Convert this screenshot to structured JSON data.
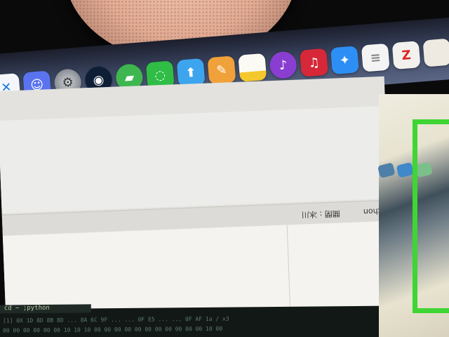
{
  "dock": {
    "icons": [
      {
        "name": "xcode-icon",
        "glyph": "✕"
      },
      {
        "name": "chat-app-icon",
        "glyph": "☺",
        "badge": true
      },
      {
        "name": "system-preferences-icon",
        "glyph": "⚙",
        "badge": true
      },
      {
        "name": "steam-icon",
        "glyph": "◉"
      },
      {
        "name": "green-app-icon",
        "glyph": "▰"
      },
      {
        "name": "wechat-icon",
        "glyph": "◌"
      },
      {
        "name": "blue-app-icon",
        "glyph": "⬆"
      },
      {
        "name": "pencil-app-icon",
        "glyph": "✎"
      },
      {
        "name": "notes-icon",
        "glyph": ""
      },
      {
        "name": "purple-app-icon",
        "glyph": "♪"
      },
      {
        "name": "red-music-icon",
        "glyph": "♫"
      },
      {
        "name": "bird-app-icon",
        "glyph": "✦"
      },
      {
        "name": "reminders-icon",
        "glyph": "≡"
      },
      {
        "name": "sketch-app-icon",
        "glyph": "Z"
      },
      {
        "name": "white-app-icon",
        "glyph": ""
      }
    ]
  },
  "window": {
    "labels": {
      "a": "關閉 : 冰川",
      "c": "ython"
    }
  },
  "terminal": {
    "header": "cd ~ ;python",
    "lines": [
      "[1] 0X 1D 8D 8B 8D ... 8A 6C 9F ... ... 0F E5 ... ... 0F AF 1a / x3",
      "00 00 00 00 00 00 10 10 10 00 00 00 00 00 00 00 00 00 00 00 10 00"
    ]
  }
}
